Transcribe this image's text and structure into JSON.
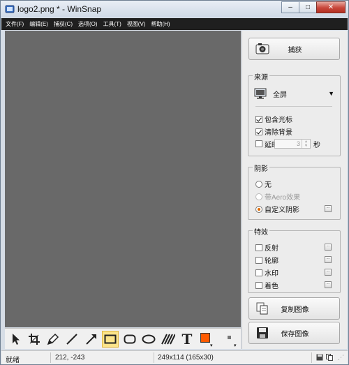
{
  "window": {
    "title": "logo2.png * - WinSnap"
  },
  "caption": {
    "minimize": "–",
    "maximize": "□",
    "close": "✕"
  },
  "menu": [
    "文件(F)",
    "编辑(E)",
    "捕获(C)",
    "选项(O)",
    "工具(T)",
    "视图(V)",
    "帮助(H)"
  ],
  "toolbar": {
    "tools": [
      "pointer-icon",
      "crop-icon",
      "pen-icon",
      "line-icon",
      "arrow-icon",
      "rectangle-icon",
      "rounded-rectangle-icon",
      "ellipse-icon",
      "hatch-icon",
      "text-icon"
    ],
    "selected": "rectangle-icon",
    "text_glyph": "T",
    "color": "#ff5a00"
  },
  "side": {
    "capture_label": "捕获",
    "source": {
      "title": "来源",
      "selected": "全屏",
      "include_cursor": {
        "label": "包含光标",
        "checked": true
      },
      "clear_background": {
        "label": "清除背景",
        "checked": true
      },
      "delay": {
        "label": "延时:",
        "checked": false,
        "value": "3",
        "unit": "秒"
      }
    },
    "shadow": {
      "title": "阴影",
      "none": "无",
      "aero": "带Aero效果",
      "custom": "自定义阴影",
      "selected": "custom"
    },
    "effects": {
      "title": "特效",
      "items": [
        "反射",
        "轮廓",
        "水印",
        "着色"
      ]
    },
    "copy_label": "复制图像",
    "save_label": "保存图像",
    "option_glyph": "..."
  },
  "status": {
    "state": "就绪",
    "coords": "212, -243",
    "size": "249x114 (165x30)"
  }
}
